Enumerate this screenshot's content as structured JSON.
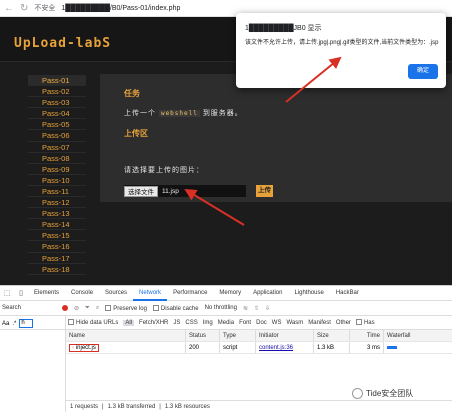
{
  "browser": {
    "security_label": "不安全",
    "url": "1█████████/B0/Pass-01/index.php"
  },
  "site": {
    "logo": "UpLoad-labS",
    "sidebar": [
      "Pass-01",
      "Pass-02",
      "Pass-03",
      "Pass-04",
      "Pass-05",
      "Pass-06",
      "Pass-07",
      "Pass-08",
      "Pass-09",
      "Pass-10",
      "Pass-11",
      "Pass-12",
      "Pass-13",
      "Pass-14",
      "Pass-15",
      "Pass-16",
      "Pass-17",
      "Pass-18"
    ],
    "task_title": "任务",
    "task_prefix": "上传一个",
    "task_code": "webshell",
    "task_suffix": "到服务器。",
    "upload_title": "上传区",
    "prompt": "请选择要上传的图片：",
    "choose_file": "选择文件",
    "file_name": "11.jsp",
    "upload_button": "上传"
  },
  "dialog": {
    "title": "1█████████JB0 显示",
    "message": "该文件不允许上传，请上传.jpg|.png|.gif类型的文件,当前文件类型为：.jsp",
    "ok": "确定"
  },
  "devtools": {
    "tabs": [
      "Elements",
      "Console",
      "Sources",
      "Network",
      "Performance",
      "Memory",
      "Application",
      "Lighthouse",
      "HackBar"
    ],
    "active_tab": "Network",
    "toolbar": {
      "preserve_log": "Preserve log",
      "disable_cache": "Disable cache",
      "throttling": "No throttling"
    },
    "search_label": "Search",
    "search_case": "Aa",
    "search_regex": ".*",
    "search_value": "h",
    "filter": {
      "hide_data_urls": "Hide data URLs",
      "types": [
        "All",
        "Fetch/XHR",
        "JS",
        "CSS",
        "Img",
        "Media",
        "Font",
        "Doc",
        "WS",
        "Wasm",
        "Manifest",
        "Other"
      ],
      "has_blocked": "Has"
    },
    "columns": [
      "Name",
      "Status",
      "Type",
      "Initiator",
      "Size",
      "Time",
      "Waterfall"
    ],
    "rows": [
      {
        "name": "inject.js",
        "status": "200",
        "type": "script",
        "initiator": "content.js:36",
        "size": "1.3 kB",
        "time": "3 ms"
      }
    ],
    "status_bar": {
      "requests": "1 requests",
      "transferred": "1.3 kB transferred",
      "resources": "1.3 kB resources"
    }
  },
  "watermark": "Tide安全团队"
}
